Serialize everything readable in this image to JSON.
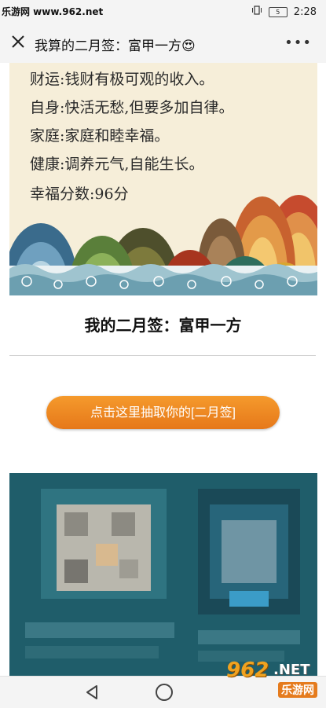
{
  "status_bar": {
    "watermark": "乐游网 www.962.net",
    "battery": "5",
    "time": "2:28",
    "icons": [
      "vibrate-icon",
      "battery-icon"
    ]
  },
  "nav": {
    "title": "我算的二月签：富甲一方😍",
    "close_icon": "close-icon",
    "more_icon": "more-icon"
  },
  "fortune": {
    "lines": [
      "财运:钱财有极可观的收入。",
      "自身:快活无愁,但要多加自律。",
      "家庭:家庭和睦幸福。",
      "健康:调养元气,自能生长。",
      "幸福分数:96分"
    ]
  },
  "result_heading": "我的二月签：富甲一方",
  "draw_button": "点击这里抽取你的[二月签]",
  "colors": {
    "button": "#f08a24",
    "card_bg": "#f6eed9",
    "qr_bg": "#1f5d6a"
  },
  "bottom_nav": {
    "back_icon": "back-triangle-icon",
    "home_icon": "home-circle-icon"
  },
  "site_logo": {
    "number": "962",
    "suffix": ".NET",
    "chinese": "乐游网"
  }
}
